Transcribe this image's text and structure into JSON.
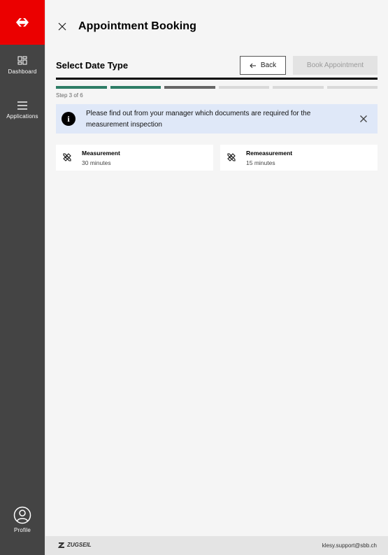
{
  "sidebar": {
    "logo": "sbb-logo-icon",
    "brand_color": "#eb0000",
    "items": [
      {
        "label": "Dashboard",
        "icon": "dashboard-icon"
      },
      {
        "label": "Applications",
        "icon": "menu-icon"
      }
    ],
    "profile": {
      "label": "Profile",
      "icon": "profile-icon"
    }
  },
  "header": {
    "title": "Appointment Booking",
    "close_icon": "close-icon"
  },
  "wizard": {
    "section_title": "Select Date Type",
    "back_label": "Back",
    "book_label": "Book Appointment",
    "step_text": "Step 3 of 6",
    "accent_color": "#2e7d66",
    "steps_total": 6,
    "steps_completed": 2
  },
  "info": {
    "text": "Please find out from your manager which documents are required for the measurement inspection",
    "background": "#dfe8f8"
  },
  "options": [
    {
      "title": "Measurement",
      "duration": "30 minutes",
      "icon": "ruler-pencil-icon"
    },
    {
      "title": "Remeasurement",
      "duration": "15 minutes",
      "icon": "ruler-pencil-icon"
    }
  ],
  "footer": {
    "brand": "ZUGSEIL",
    "email": "klesy.support@sbb.ch"
  }
}
